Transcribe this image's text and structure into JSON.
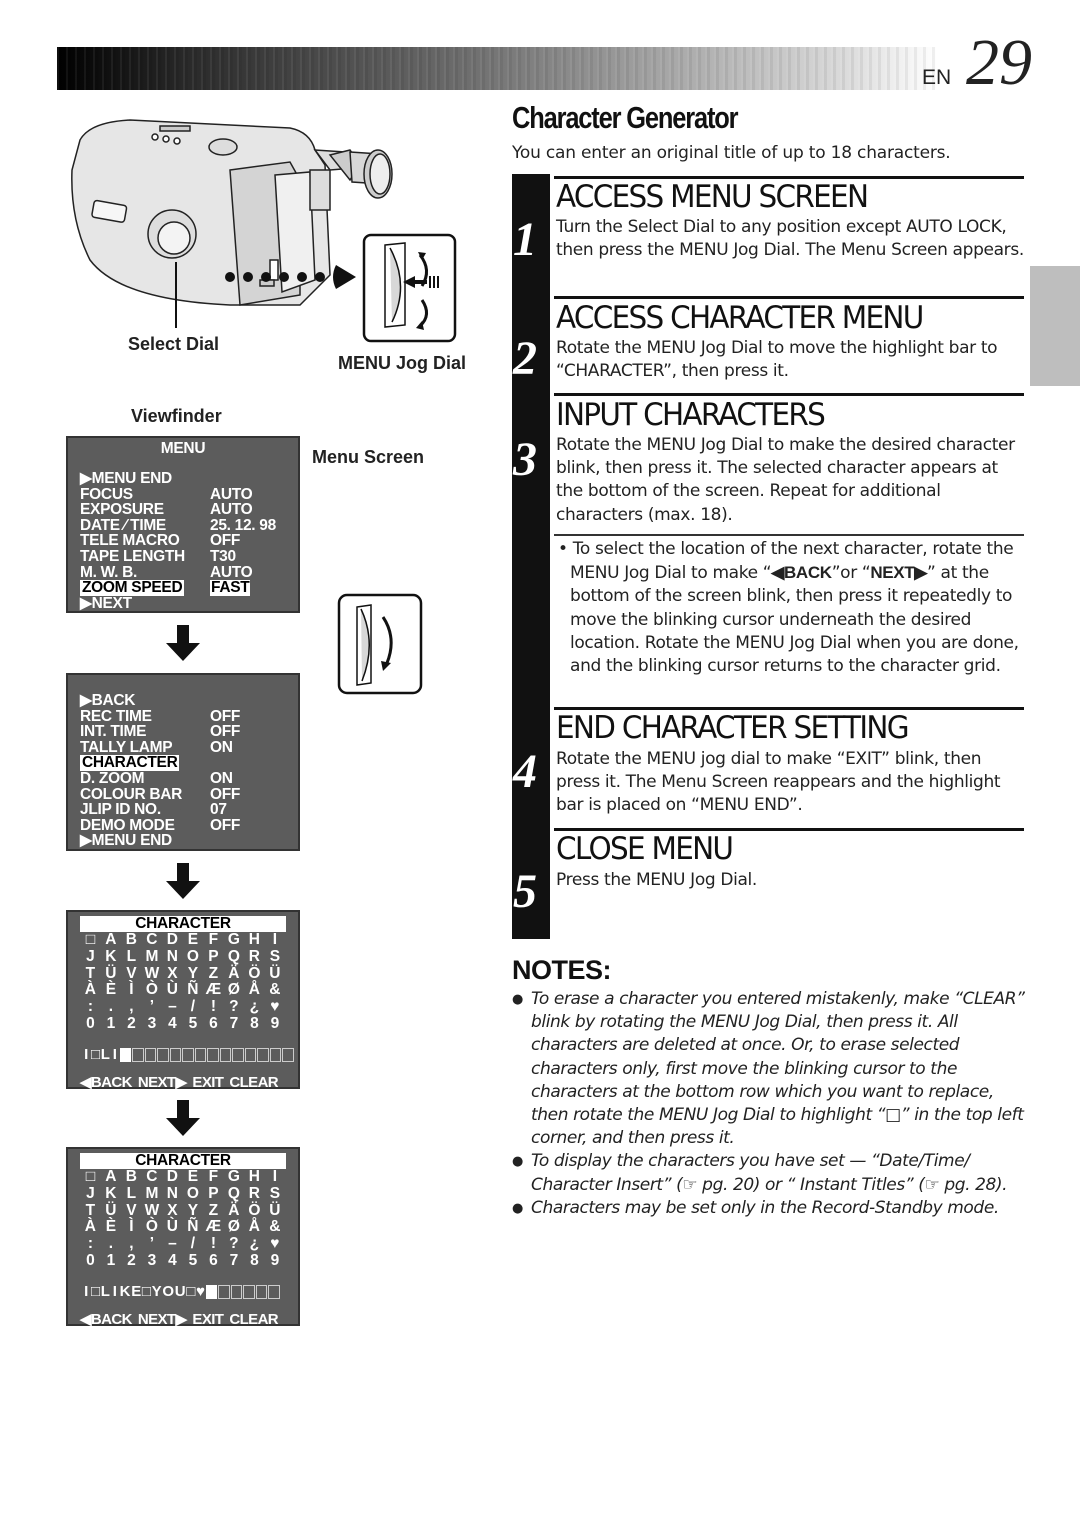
{
  "header": {
    "lang": "EN",
    "page_number": "29"
  },
  "illustration": {
    "select_dial_label": "Select Dial",
    "menu_jog_dial_label": "MENU Jog Dial",
    "viewfinder_label": "Viewfinder",
    "menu_screen_label": "Menu Screen"
  },
  "osd_menu1": {
    "title": "MENU",
    "rows": [
      {
        "k": "▶MENU  END",
        "v": ""
      },
      {
        "k": "FOCUS",
        "v": "AUTO"
      },
      {
        "k": "EXPOSURE",
        "v": "AUTO"
      },
      {
        "k": "DATE ⁄ TIME",
        "v": "25. 12. 98"
      },
      {
        "k": "TELE  MACRO",
        "v": "OFF"
      },
      {
        "k": "TAPE  LENGTH",
        "v": "T30"
      },
      {
        "k": "M. W. B.",
        "v": "AUTO"
      },
      {
        "k": "ZOOM SPEED",
        "v": "FAST"
      },
      {
        "k": "▶NEXT",
        "v": ""
      }
    ]
  },
  "osd_menu2": {
    "rows": [
      {
        "k": "▶BACK",
        "v": ""
      },
      {
        "k": "REC  TIME",
        "v": "OFF"
      },
      {
        "k": "INT.  TIME",
        "v": "OFF"
      },
      {
        "k": "TALLY  LAMP",
        "v": "ON"
      },
      {
        "k": "CHARACTER",
        "v": ""
      },
      {
        "k": "D.  ZOOM",
        "v": "ON"
      },
      {
        "k": "COLOUR  BAR",
        "v": "OFF"
      },
      {
        "k": "JLIP  ID  NO.",
        "v": "07"
      },
      {
        "k": "DEMO  MODE",
        "v": "OFF"
      },
      {
        "k": "▶MENU  END",
        "v": ""
      }
    ]
  },
  "osd_char": {
    "title": "CHARACTER",
    "grid": [
      "□",
      "A",
      "B",
      "C",
      "D",
      "E",
      "F",
      "G",
      "H",
      "I",
      "J",
      "K",
      "L",
      "M",
      "N",
      "O",
      "P",
      "Q",
      "R",
      "S",
      "T",
      "Ü",
      "V",
      "W",
      "X",
      "Y",
      "Z",
      "Ä",
      "Ö",
      "Ü",
      "À",
      "È",
      "Ì",
      "Ò",
      "Ù",
      "Ñ",
      "Æ",
      "Ø",
      "Å",
      "&",
      ":",
      ".",
      ",",
      "’",
      "–",
      "/",
      "!",
      "?",
      "¿",
      "♥",
      "0",
      "1",
      "2",
      "3",
      "4",
      "5",
      "6",
      "7",
      "8",
      "9"
    ],
    "footer": [
      "◀BACK",
      "NEXT▶",
      "EXIT",
      "CLEAR"
    ],
    "entry1": [
      "I",
      "□",
      "L",
      "I"
    ],
    "entry2": [
      "I",
      "□",
      "L",
      "I",
      "K",
      "E",
      "□",
      "Y",
      "O",
      "U",
      "□",
      "♥"
    ]
  },
  "section": {
    "title": "Character Generator",
    "intro": "You can enter an original title of up to 18 characters."
  },
  "steps": [
    {
      "num": "1",
      "heading": "ACCESS MENU SCREEN",
      "text": "Turn the Select Dial to any position except AUTO LOCK, then press the MENU Jog Dial. The Menu Screen appears."
    },
    {
      "num": "2",
      "heading": "ACCESS CHARACTER MENU",
      "text": "Rotate the MENU Jog Dial to move the highlight bar to “CHARACTER”, then press it."
    },
    {
      "num": "3",
      "heading": "INPUT CHARACTERS",
      "text": "Rotate the MENU Jog Dial to make the desired character blink, then press it. The selected character appears at the bottom of the screen. Repeat for additional characters (max. 18).",
      "bullet_pre": "• To select the location of the next character, rotate the MENU Jog Dial to make “",
      "bullet_back": "◀BACK",
      "bullet_mid": "”or “",
      "bullet_next": "NEXT▶",
      "bullet_post": "” at the bottom of the screen blink, then press it repeatedly to move the blinking cursor underneath the desired location. Rotate the MENU Jog Dial when you are done, and the blinking cursor returns to the character grid."
    },
    {
      "num": "4",
      "heading": "END CHARACTER SETTING",
      "text": "Rotate the MENU jog dial to make “EXIT” blink, then press it. The Menu Screen reappears and the highlight bar is placed on “MENU END”."
    },
    {
      "num": "5",
      "heading": "CLOSE MENU",
      "text": "Press the MENU Jog Dial."
    }
  ],
  "notes": {
    "heading": "NOTES:",
    "items": [
      "To erase a character you entered mistakenly, make “CLEAR” blink by rotating the MENU Jog Dial, then press it. All characters are deleted at once. Or, to erase selected characters only, first move the blinking cursor to the characters at the bottom row which you want to replace, then rotate the MENU Jog Dial to highlight “□” in the top left corner, and then press it.",
      "To display the characters you have set — “Date/Time/ Character Insert” (☞ pg. 20) or “ Instant Titles” (☞ pg. 28).",
      "Characters may be set only in the Record-Standby mode."
    ]
  }
}
